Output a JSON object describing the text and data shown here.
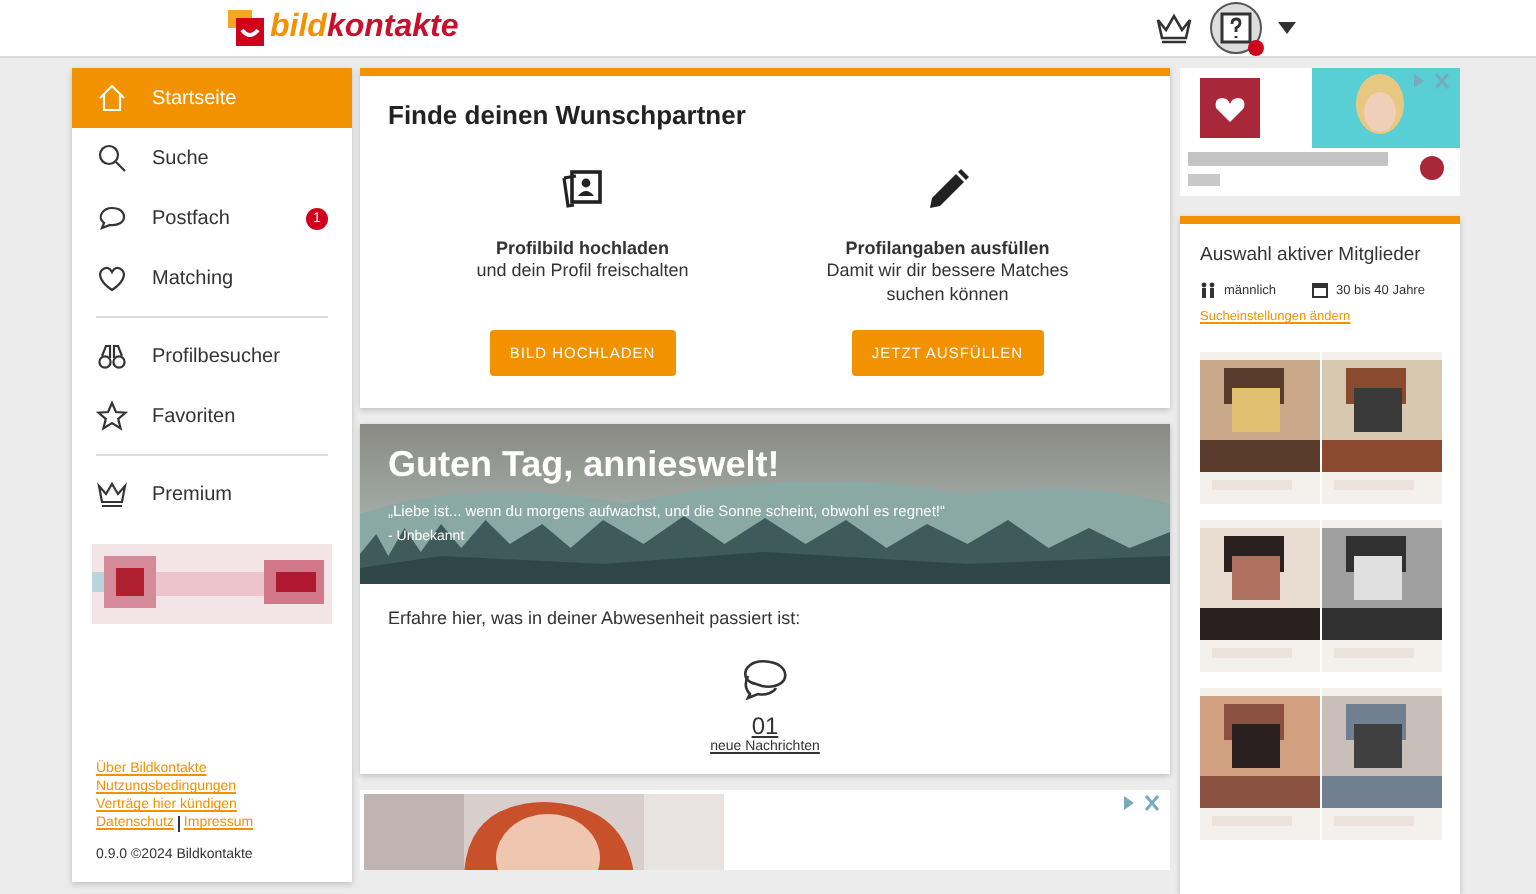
{
  "header": {
    "logo_parts": [
      "bild",
      "kontakte"
    ]
  },
  "sidebar": {
    "groups": [
      [
        {
          "label": "Startseite",
          "kind": "home",
          "selected": true
        },
        {
          "label": "Suche",
          "kind": "search",
          "selected": false
        },
        {
          "label": "Postfach",
          "kind": "chat",
          "selected": false,
          "badge": "1"
        },
        {
          "label": "Matching",
          "kind": "heart",
          "selected": false
        }
      ],
      [
        {
          "label": "Profilbesucher",
          "kind": "binoculars",
          "selected": false
        },
        {
          "label": "Favoriten",
          "kind": "star",
          "selected": false
        }
      ],
      [
        {
          "label": "Premium",
          "kind": "crown",
          "selected": false
        }
      ]
    ],
    "footer_links": [
      [
        "Über Bildkontakte"
      ],
      [
        "Nutzungsbedingungen"
      ],
      [
        "Verträge hier kündigen"
      ],
      [
        "Datenschutz",
        "Impressum"
      ]
    ],
    "version": "0.9.0 ©2024 Bildkontakte"
  },
  "partner_card": {
    "title": "Finde deinen Wunschpartner",
    "tasks": [
      {
        "kind": "photos",
        "title": "Profilbild hochladen",
        "text": "und dein Profil freischalten",
        "button": "BILD HOCHLADEN"
      },
      {
        "kind": "pencil",
        "title": "Profilangaben ausfüllen",
        "text": "Damit wir dir bessere Matches suchen können",
        "button": "JETZT AUSFÜLLEN"
      }
    ]
  },
  "greeting": {
    "title": "Guten Tag, annieswelt!",
    "quote": "„Liebe ist... wenn du morgens aufwachst, und die Sonne scheint, obwohl es regnet!“",
    "author": "- Unbekannt",
    "intro": "Erfahre hier, was in deiner Abwesenheit passiert ist:",
    "count": "01",
    "count_label": "neue Nachrichten"
  },
  "members": {
    "title": "Auswahl aktiver Mitglieder",
    "gender": "männlich",
    "age": "30 bis 40 Jahre",
    "settings_link": "Sucheinstellungen ändern"
  }
}
